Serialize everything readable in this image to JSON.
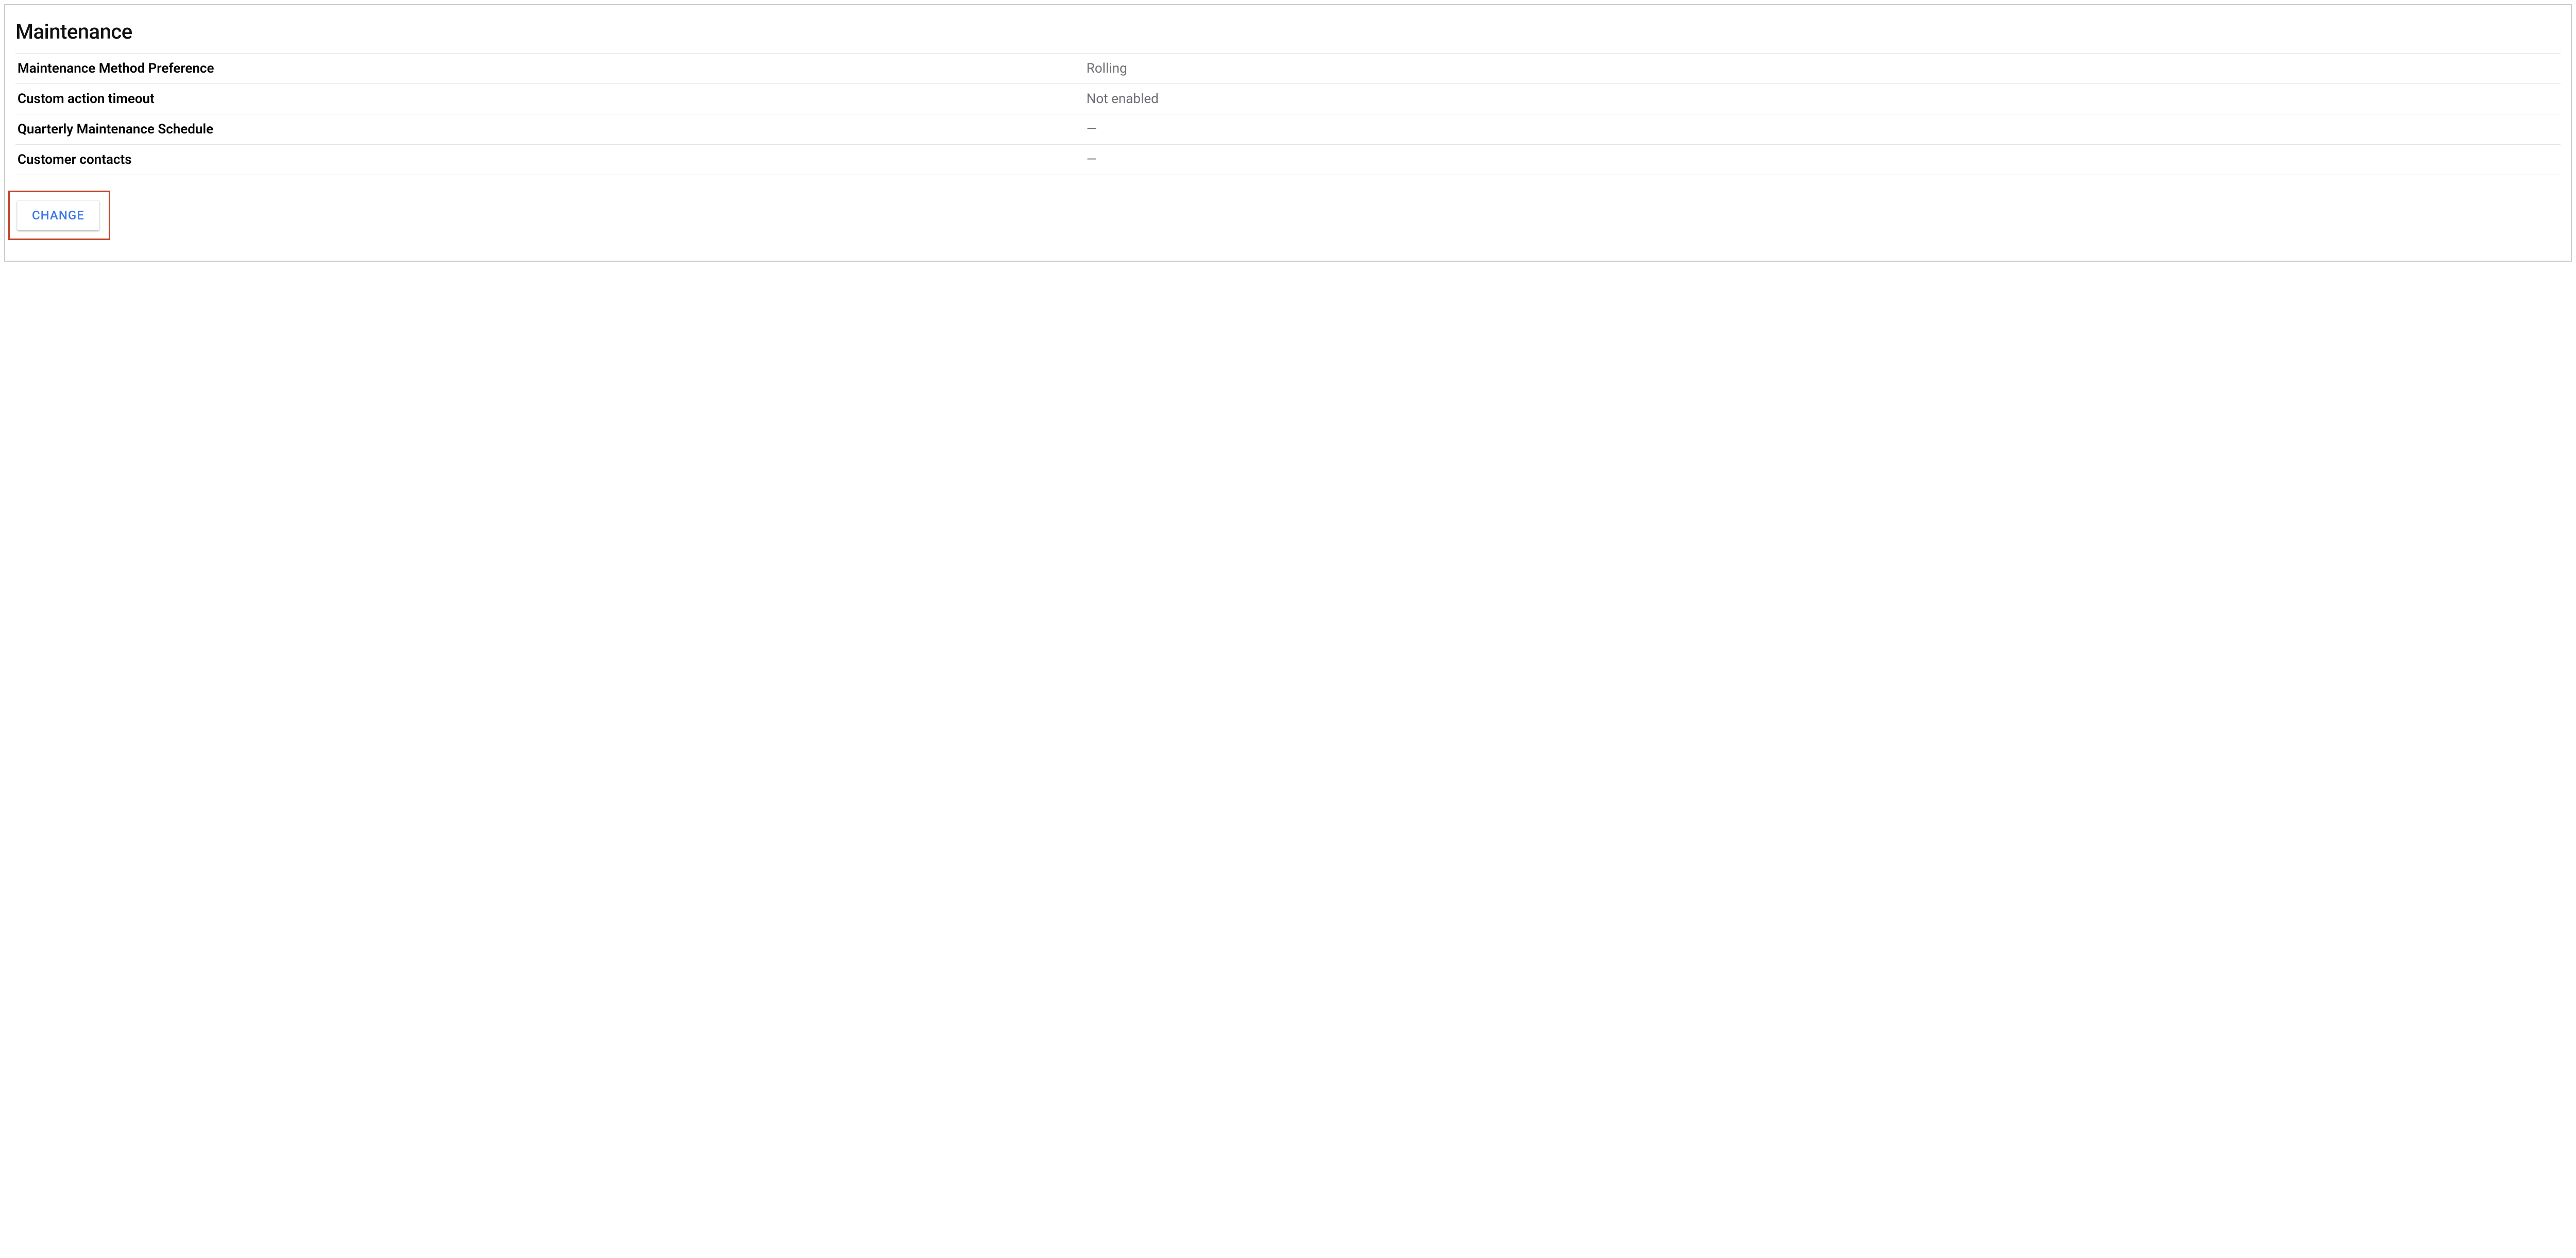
{
  "section": {
    "title": "Maintenance",
    "rows": [
      {
        "label": "Maintenance Method Preference",
        "value": "Rolling"
      },
      {
        "label": "Custom action timeout",
        "value": "Not enabled"
      },
      {
        "label": "Quarterly Maintenance Schedule",
        "value": "—"
      },
      {
        "label": "Customer contacts",
        "value": "—"
      }
    ],
    "changeButtonLabel": "CHANGE"
  }
}
